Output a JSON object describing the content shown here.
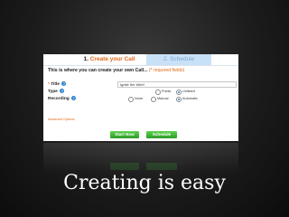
{
  "tabs": {
    "step1_number": "1.",
    "step1_label": "Create your Call",
    "step2_label": "2. Schedule"
  },
  "form": {
    "intro_prefix": "This is where you can create your own Call...",
    "intro_required": "(* required fields)",
    "title_label": "Title",
    "title_value": "Ignite the Web!",
    "type_label": "Type",
    "type_options": [
      "Public",
      "Unlisted"
    ],
    "type_selected": "Unlisted",
    "recording_label": "Recording",
    "recording_options": [
      "None",
      "Manual",
      "Automatic"
    ],
    "recording_selected": "Automatic",
    "advanced_options": "Advanced Options",
    "start_now": "Start Now",
    "schedule": "Schedule"
  },
  "caption": "Creating is easy",
  "colors": {
    "accent_blue": "#1e8be0",
    "accent_orange": "#e06a1a",
    "button_green": "#3fb63a"
  }
}
